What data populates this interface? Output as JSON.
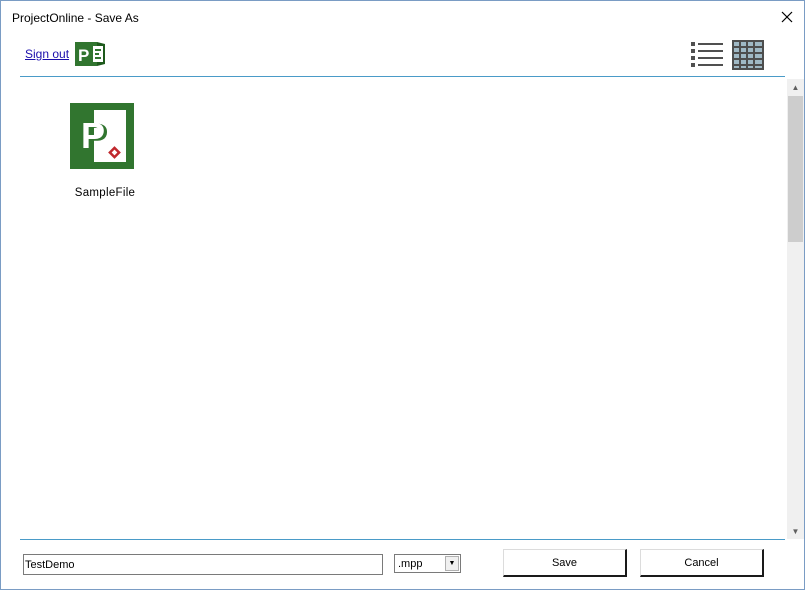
{
  "window": {
    "title": "ProjectOnline - Save As"
  },
  "header": {
    "sign_out_label": "Sign out",
    "logo_icon": "project-logo-icon",
    "view_list_icon": "list-view-icon",
    "view_grid_icon": "grid-view-icon"
  },
  "files": [
    {
      "name": "SampleFile",
      "icon": "project-file-icon"
    }
  ],
  "footer": {
    "filename_value": "TestDemo",
    "extension_selected": ".mpp",
    "save_label": "Save",
    "cancel_label": "Cancel"
  },
  "colors": {
    "accent_rule": "#4a9bc8",
    "project_green": "#31752f",
    "link": "#1a0dab"
  }
}
